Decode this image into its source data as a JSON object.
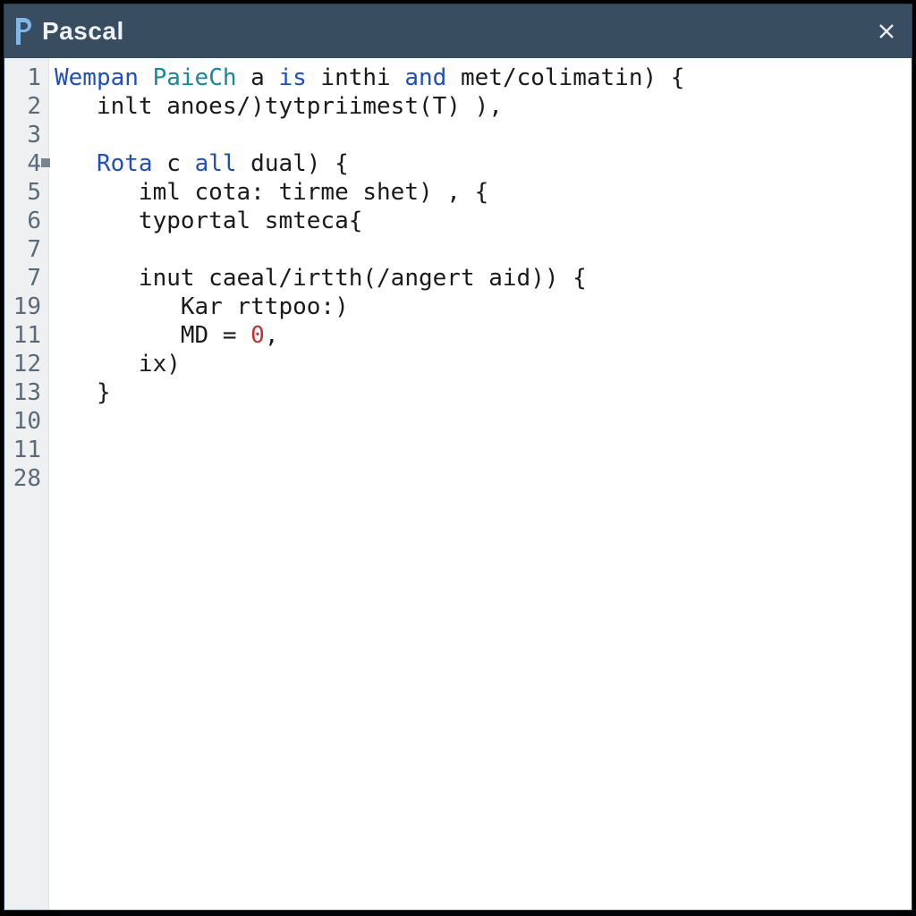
{
  "header": {
    "title": "Pascal",
    "logo_letter": "P",
    "close_label": "Close"
  },
  "colors": {
    "titlebar_bg": "#394d60",
    "gutter_bg": "#eef0f2",
    "keyword": "#1f4fbf",
    "keyword_alt": "#148a9a",
    "number": "#c03030"
  },
  "editor": {
    "marked_line": 4,
    "line_numbers": [
      "1",
      "2",
      "3",
      "4",
      "5",
      "6",
      "7",
      "7",
      "19",
      "11",
      "12",
      "13",
      "10",
      "11",
      "28"
    ],
    "lines": [
      {
        "indent": 0,
        "tokens": [
          {
            "t": "Wempan",
            "c": "kw1"
          },
          {
            "t": " "
          },
          {
            "t": "PaieCh",
            "c": "kw3"
          },
          {
            "t": " a "
          },
          {
            "t": "is",
            "c": "kw2"
          },
          {
            "t": " inthi "
          },
          {
            "t": "and",
            "c": "kw2"
          },
          {
            "t": " met/colimatin) {"
          }
        ]
      },
      {
        "indent": 1,
        "tokens": [
          {
            "t": "inlt anoes/)tytpriimest(T) ),"
          }
        ]
      },
      {
        "indent": 0,
        "tokens": []
      },
      {
        "indent": 1,
        "tokens": [
          {
            "t": "Rota",
            "c": "kw1"
          },
          {
            "t": " c "
          },
          {
            "t": "all",
            "c": "kw2"
          },
          {
            "t": " dual) {"
          }
        ]
      },
      {
        "indent": 2,
        "tokens": [
          {
            "t": "iml cota: tirme shet) , {"
          }
        ]
      },
      {
        "indent": 2,
        "tokens": [
          {
            "t": "typortal smteca{"
          }
        ]
      },
      {
        "indent": 0,
        "tokens": []
      },
      {
        "indent": 2,
        "tokens": [
          {
            "t": "inut caeal/irtth(/angert aid)) {"
          }
        ]
      },
      {
        "indent": 3,
        "tokens": [
          {
            "t": "Kar rttpoo:)"
          }
        ]
      },
      {
        "indent": 3,
        "tokens": [
          {
            "t": "MD = "
          },
          {
            "t": "0",
            "c": "num"
          },
          {
            "t": ","
          }
        ]
      },
      {
        "indent": 2,
        "tokens": [
          {
            "t": "ix)"
          }
        ]
      },
      {
        "indent": 1,
        "tokens": [
          {
            "t": "}"
          }
        ]
      },
      {
        "indent": 0,
        "tokens": []
      },
      {
        "indent": 0,
        "tokens": []
      },
      {
        "indent": 0,
        "tokens": []
      }
    ]
  }
}
